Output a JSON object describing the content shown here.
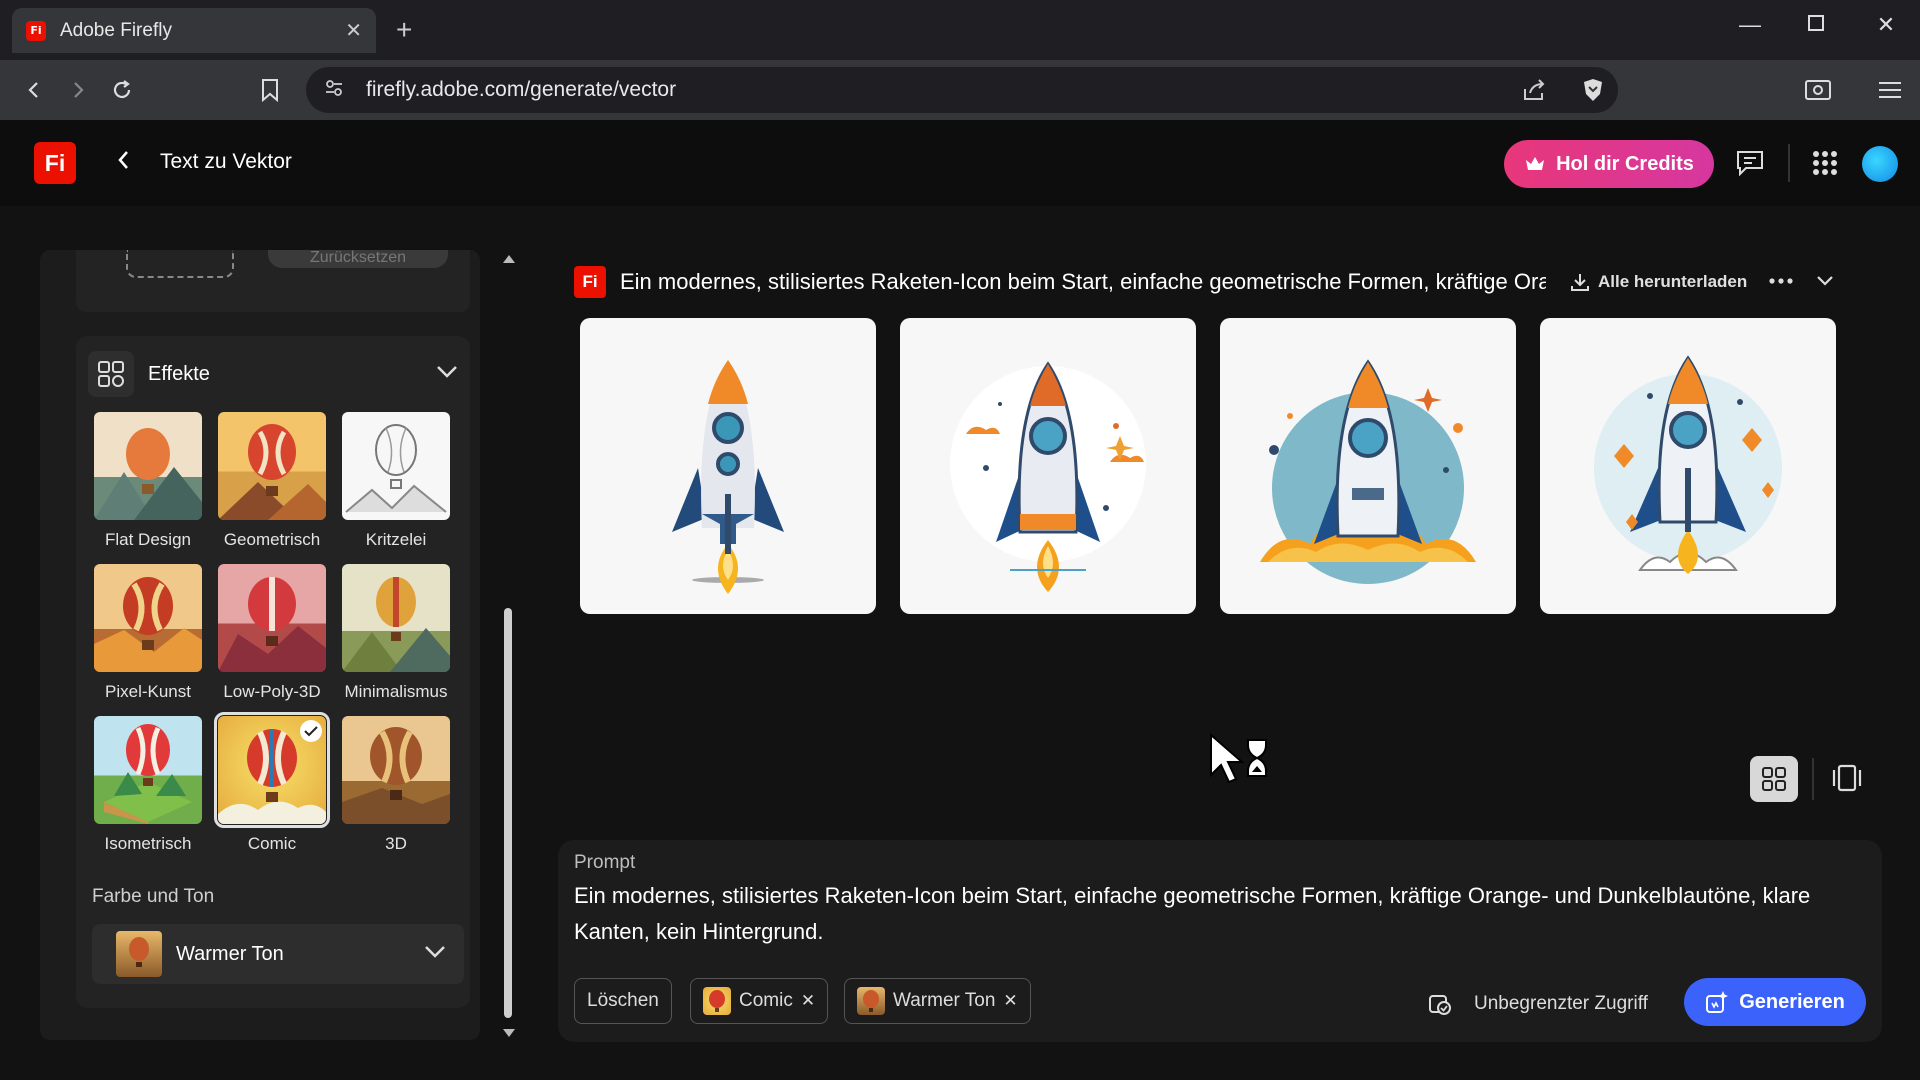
{
  "browser": {
    "tab_title": "Adobe Firefly",
    "favicon_text": "Fi",
    "url": "firefly.adobe.com/generate/vector"
  },
  "header": {
    "logo_text": "Fi",
    "title": "Text zu Vektor",
    "credits_label": "Hol dir Credits",
    "accent_pink": "#e8377a",
    "accent_blue": "#3b63fb"
  },
  "sidebar": {
    "reset_label": "Zurücksetzen",
    "effects_title": "Effekte",
    "effects": [
      {
        "label": "Flat Design",
        "selected": false
      },
      {
        "label": "Geometrisch",
        "selected": false
      },
      {
        "label": "Kritzelei",
        "selected": false
      },
      {
        "label": "Pixel-Kunst",
        "selected": false
      },
      {
        "label": "Low-Poly-3D",
        "selected": false
      },
      {
        "label": "Minimalismus",
        "selected": false
      },
      {
        "label": "Isometrisch",
        "selected": false
      },
      {
        "label": "Comic",
        "selected": true
      },
      {
        "label": "3D",
        "selected": false
      }
    ],
    "color_section_label": "Farbe und Ton",
    "color_selected": "Warmer Ton"
  },
  "results": {
    "logo_text": "Fi",
    "prompt_title": "Ein modernes, stilisiertes Raketen-Icon beim Start, einfache geometrische Formen, kräftige Orar",
    "download_all": "Alle herunterladen"
  },
  "prompt": {
    "label": "Prompt",
    "text": "Ein modernes, stilisiertes Raketen-Icon beim Start, einfache geometrische Formen, kräftige Orange- und Dunkelblautöne, klare Kanten, kein Hintergrund.",
    "clear_label": "Löschen",
    "chips": [
      {
        "label": "Comic"
      },
      {
        "label": "Warmer Ton"
      }
    ],
    "access_label": "Unbegrenzter Zugriff",
    "generate_label": "Generieren"
  }
}
